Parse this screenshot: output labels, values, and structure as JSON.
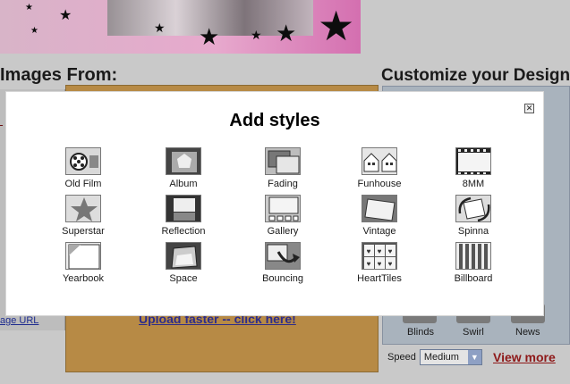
{
  "background": {
    "left_heading": "Images From:",
    "right_heading": "Customize your Design",
    "upload_link": "Upload faster -- click here!",
    "image_url_link": "age URL",
    "right_items": [
      "Blinds",
      "Swirl",
      "News"
    ],
    "speed_label": "Speed",
    "speed_value": "Medium",
    "view_more": "View more",
    "accent_pink": "#d46fb0",
    "orange_panel": "#b78a45"
  },
  "modal": {
    "title": "Add styles",
    "close_icon": "close-icon",
    "styles": [
      {
        "label": "Old Film",
        "icon": "old-film-icon"
      },
      {
        "label": "Album",
        "icon": "album-icon"
      },
      {
        "label": "Fading",
        "icon": "fading-icon"
      },
      {
        "label": "Funhouse",
        "icon": "funhouse-icon"
      },
      {
        "label": "8MM",
        "icon": "8mm-icon"
      },
      {
        "label": "Superstar",
        "icon": "superstar-icon"
      },
      {
        "label": "Reflection",
        "icon": "reflection-icon"
      },
      {
        "label": "Gallery",
        "icon": "gallery-icon"
      },
      {
        "label": "Vintage",
        "icon": "vintage-icon"
      },
      {
        "label": "Spinna",
        "icon": "spinna-icon"
      },
      {
        "label": "Yearbook",
        "icon": "yearbook-icon"
      },
      {
        "label": "Space",
        "icon": "space-icon"
      },
      {
        "label": "Bouncing",
        "icon": "bouncing-icon"
      },
      {
        "label": "HeartTiles",
        "icon": "hearttiles-icon"
      },
      {
        "label": "Billboard",
        "icon": "billboard-icon"
      }
    ]
  }
}
